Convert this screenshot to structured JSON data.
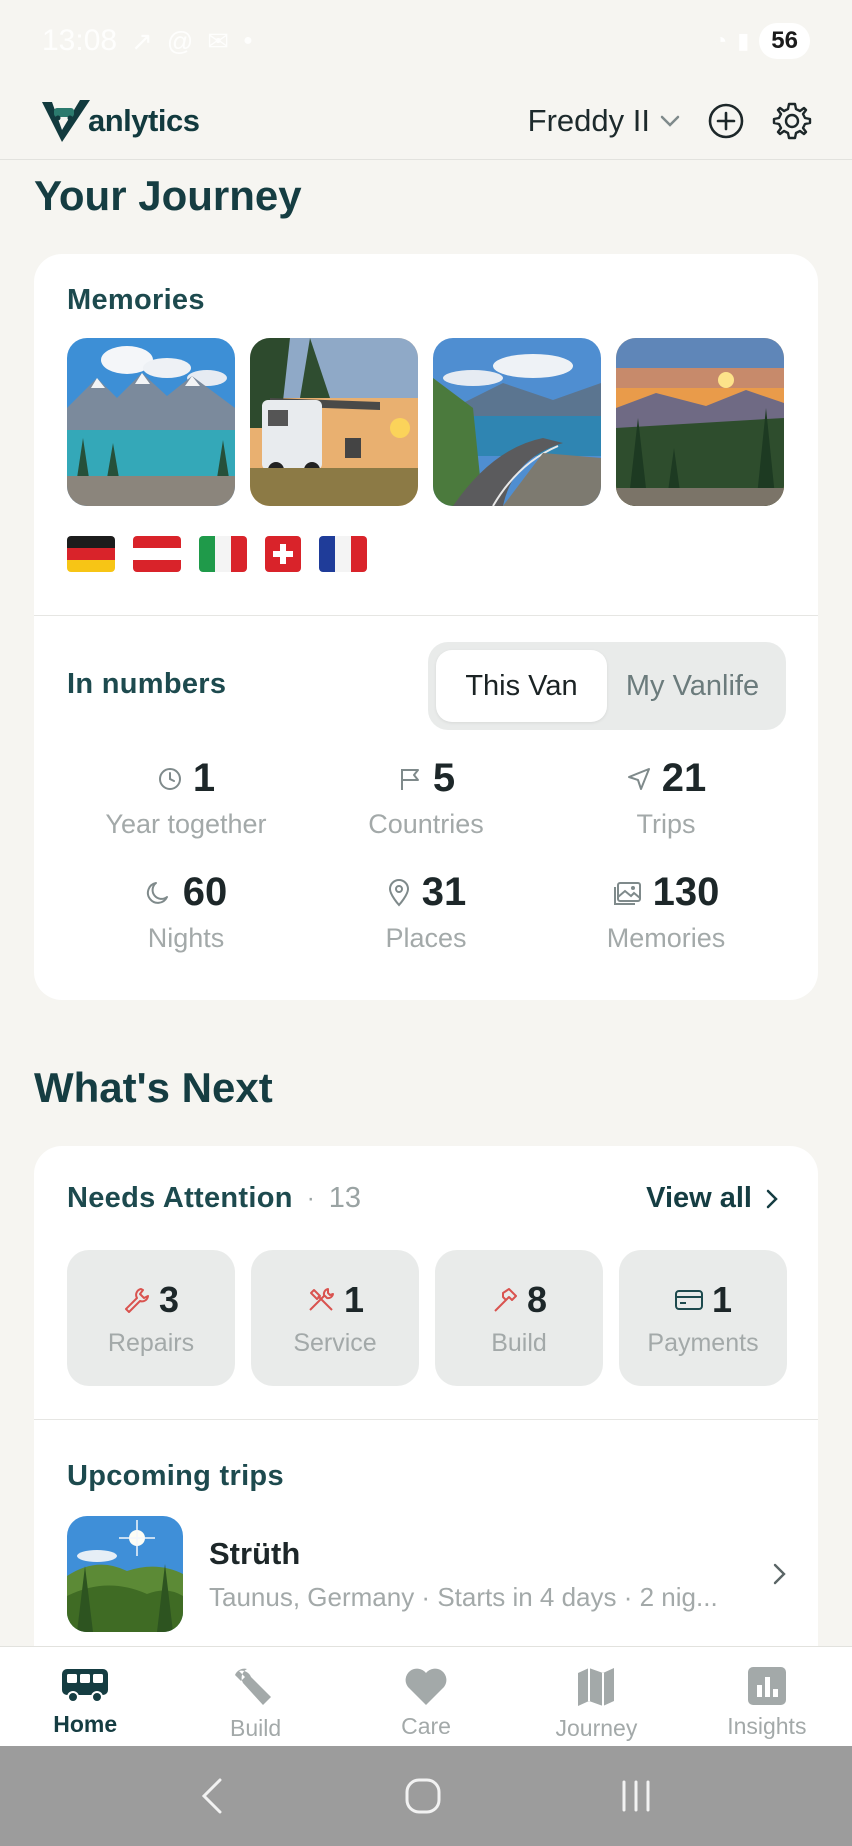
{
  "status_bar": {
    "time": "13:08",
    "battery": "56"
  },
  "header": {
    "brand_rest": "anlytics",
    "van_name": "Freddy II"
  },
  "journey": {
    "title": "Your Journey",
    "memories_label": "Memories",
    "in_numbers_label": "In numbers",
    "toggle": {
      "active": "This Van",
      "inactive": "My Vanlife"
    },
    "stats": [
      {
        "icon": "clock-icon",
        "value": "1",
        "label": "Year together"
      },
      {
        "icon": "flag-icon",
        "value": "5",
        "label": "Countries"
      },
      {
        "icon": "navigation-icon",
        "value": "21",
        "label": "Trips"
      },
      {
        "icon": "moon-icon",
        "value": "60",
        "label": "Nights"
      },
      {
        "icon": "map-pin-icon",
        "value": "31",
        "label": "Places"
      },
      {
        "icon": "images-icon",
        "value": "130",
        "label": "Memories"
      }
    ],
    "flags": [
      "germany",
      "austria",
      "italy",
      "switzerland",
      "france"
    ]
  },
  "next": {
    "title": "What's Next",
    "needs_attention_label": "Needs Attention",
    "needs_attention_count": "13",
    "view_all": "View all",
    "tiles": [
      {
        "icon": "wrench-icon",
        "value": "3",
        "label": "Repairs"
      },
      {
        "icon": "tools-icon",
        "value": "1",
        "label": "Service"
      },
      {
        "icon": "hammer-icon",
        "value": "8",
        "label": "Build"
      },
      {
        "icon": "credit-card-icon",
        "value": "1",
        "label": "Payments"
      }
    ],
    "upcoming_label": "Upcoming trips",
    "trip": {
      "name": "Strüth",
      "details": "Taunus, Germany · Starts in 4 days · 2 nig..."
    }
  },
  "nav": {
    "home": "Home",
    "build": "Build",
    "care": "Care",
    "journey": "Journey",
    "insights": "Insights"
  },
  "colors": {
    "primary": "#153d42",
    "accent_red": "#d9534f",
    "muted": "#a3a9a9"
  }
}
